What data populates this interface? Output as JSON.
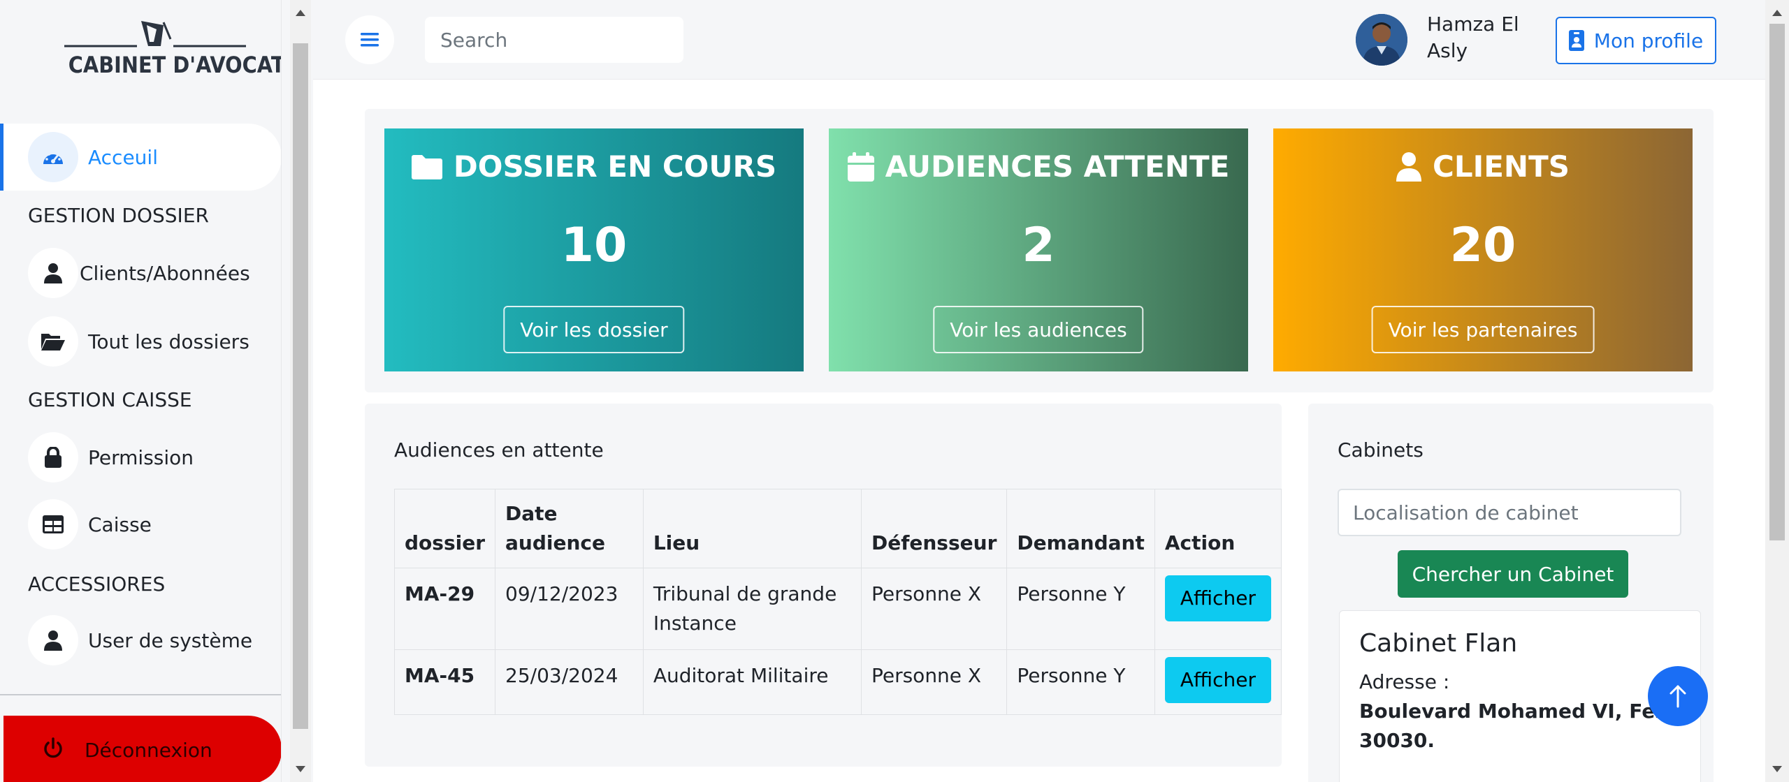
{
  "logo": {
    "text": "CABINET D'AVOCAT"
  },
  "sidebar": {
    "home": {
      "label": "Acceuil",
      "icon": "tachometer-icon"
    },
    "sections": [
      {
        "title": "GESTION DOSSIER"
      },
      {
        "title": "GESTION CAISSE"
      },
      {
        "title": "ACCESSIORES"
      }
    ],
    "items": [
      {
        "label": "Clients/Abonnées",
        "icon": "user-icon"
      },
      {
        "label": "Tout les dossiers",
        "icon": "folder-open-icon"
      },
      {
        "label": "Permission",
        "icon": "lock-icon"
      },
      {
        "label": "Caisse",
        "icon": "table-icon"
      },
      {
        "label": "User de système",
        "icon": "user-icon"
      }
    ],
    "logout": {
      "label": "Déconnexion",
      "icon": "power-icon"
    }
  },
  "topbar": {
    "search_placeholder": "Search",
    "user_name": "Hamza El Asly",
    "profile_button": "Mon profile"
  },
  "stats": [
    {
      "title": "DOSSIER EN COURS",
      "value": "10",
      "button": "Voir les dossier",
      "icon": "folder-icon"
    },
    {
      "title": "AUDIENCES ATTENTE",
      "value": "2",
      "button": "Voir les audiences",
      "icon": "calendar-icon"
    },
    {
      "title": "CLIENTS",
      "value": "20",
      "button": "Voir les partenaires",
      "icon": "user-icon"
    }
  ],
  "audiences": {
    "title": "Audiences en attente",
    "columns": [
      "dossier",
      "Date audience",
      "Lieu",
      "Défensseur",
      "Demandant",
      "Action"
    ],
    "rows": [
      {
        "dossier": "MA-29",
        "date": "09/12/2023",
        "lieu": "Tribunal de grande Instance",
        "defenseur": "Personne X",
        "demandant": "Personne Y",
        "action": "Afficher"
      },
      {
        "dossier": "MA-45",
        "date": "25/03/2024",
        "lieu": "Auditorat Militaire",
        "defenseur": "Personne X",
        "demandant": "Personne Y",
        "action": "Afficher"
      }
    ]
  },
  "cabinets": {
    "title": "Cabinets",
    "input_placeholder": "Localisation de cabinet",
    "search_button": "Chercher un Cabinet",
    "card": {
      "name": "Cabinet Flan",
      "address_label": "Adresse :",
      "address": "Boulevard Mohamed VI, Fes 30030."
    }
  },
  "colors": {
    "accent": "#1a73e8",
    "logout": "#dd0000",
    "card1": "#23bcc0",
    "card2": "#80e0ac",
    "card3": "#ffab00",
    "success": "#198754",
    "info": "#0dcaf0"
  }
}
